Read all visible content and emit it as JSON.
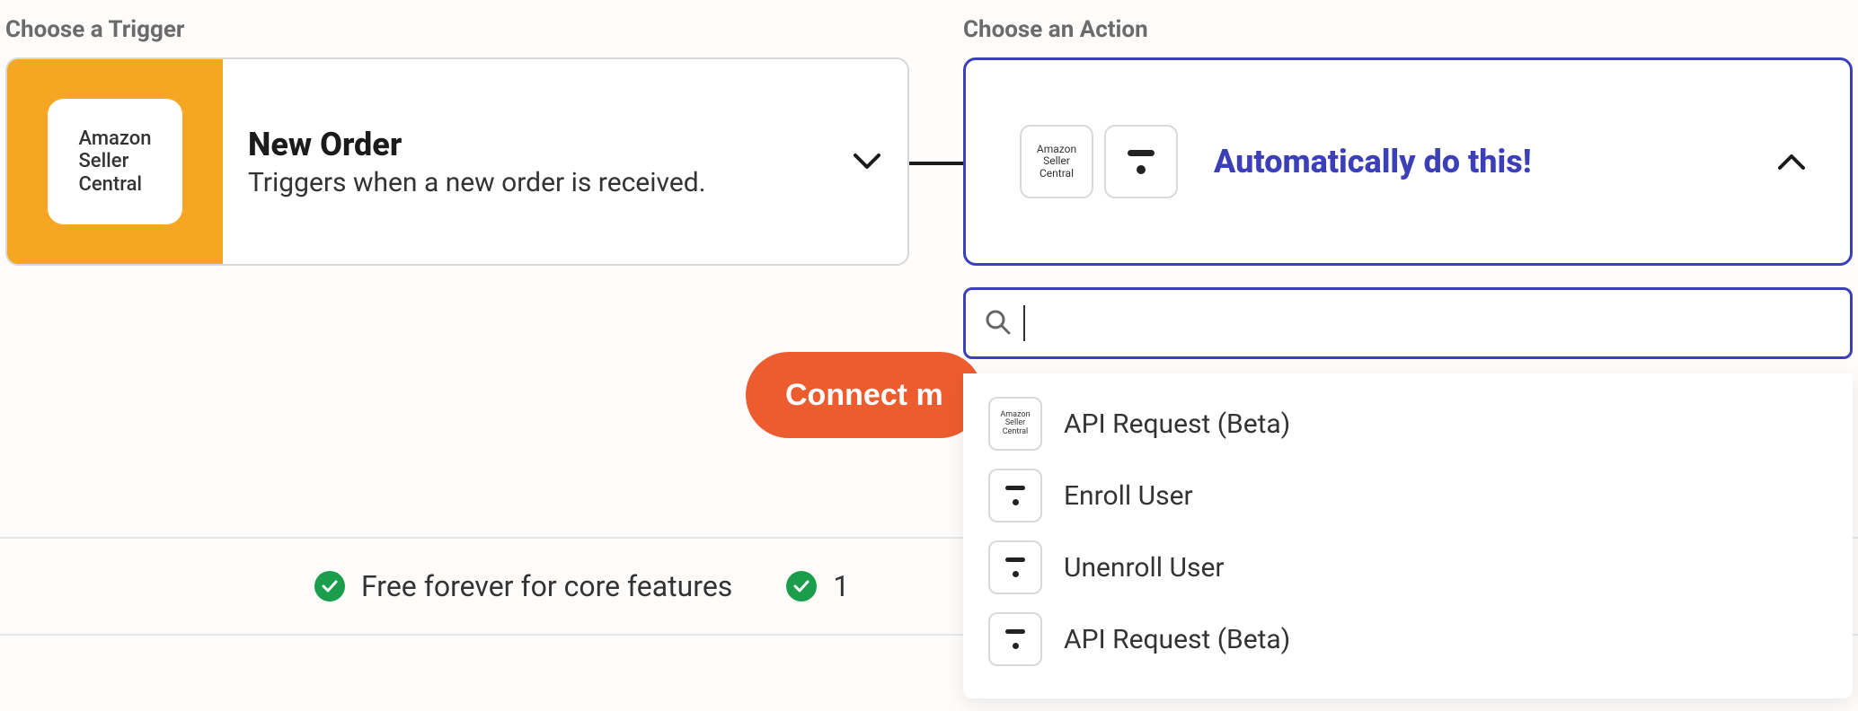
{
  "labels": {
    "trigger": "Choose a Trigger",
    "action": "Choose an Action"
  },
  "trigger": {
    "app_icon_text": "Amazon\nSeller\nCentral",
    "title": "New Order",
    "description": "Triggers when a new order is received."
  },
  "action": {
    "app_icon_text": "Amazon\nSeller\nCentral",
    "title": "Automatically do this!"
  },
  "search": {
    "value": ""
  },
  "dropdown": {
    "items": [
      {
        "icon_kind": "amazon",
        "label": "API Request (Beta)"
      },
      {
        "icon_kind": "thinkific",
        "label": "Enroll User"
      },
      {
        "icon_kind": "thinkific",
        "label": "Unenroll User"
      },
      {
        "icon_kind": "thinkific",
        "label": "API Request (Beta)"
      }
    ],
    "amazon_icon_text": "Amazon\nSeller\nCentral"
  },
  "connect_button": "Connect m",
  "features": {
    "item1": "Free forever for core features",
    "item2": "1"
  },
  "colors": {
    "accent_orange": "#f5a623",
    "primary_blue": "#3b3fb8",
    "cta_orange": "#ed5c2f",
    "success_green": "#1a9e4b"
  }
}
